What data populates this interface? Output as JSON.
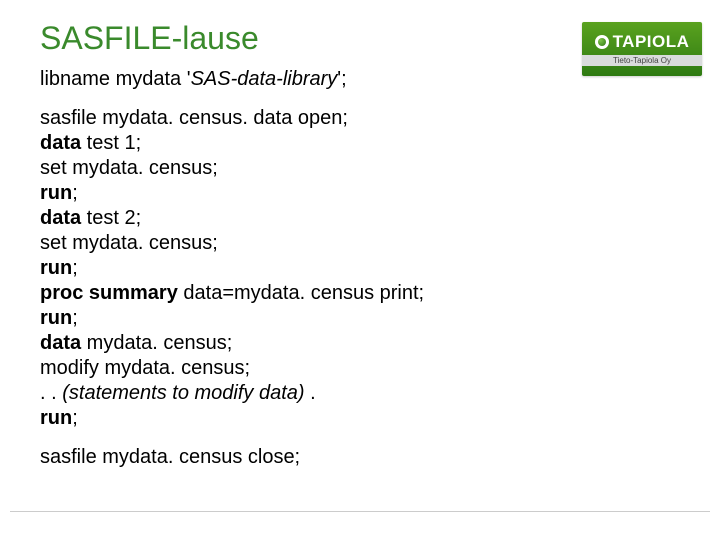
{
  "title": "SASFILE-lause",
  "logo": {
    "main": "TAPIOLA",
    "sub": "Tieto-Tapiola Oy"
  },
  "libname": {
    "prefix": "libname mydata '",
    "lib": "SAS-data-library",
    "suffix": "';"
  },
  "code": {
    "l1": "sasfile mydata. census. data open;",
    "l2a": "data",
    "l2b": " test 1;",
    "l3": "set mydata. census;",
    "l4a": "run",
    "l4b": ";",
    "l5a": "data",
    "l5b": " test 2;",
    "l6": "set mydata. census;",
    "l7a": "run",
    "l7b": ";",
    "l8a": "proc summary",
    "l8b": " data=mydata. census print;",
    "l9a": "run",
    "l9b": ";",
    "l10a": "data",
    "l10b": " mydata. census;",
    "l11": "modify mydata. census;",
    "l12a": ". . ",
    "l12b": "(statements to modify data)",
    "l12c": " .",
    "l13a": "run",
    "l13b": ";"
  },
  "close": "sasfile mydata. census close;"
}
